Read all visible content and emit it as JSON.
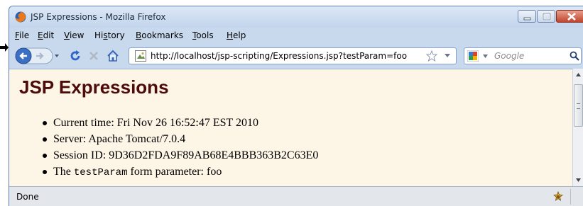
{
  "window": {
    "title": "JSP Expressions - Mozilla Firefox"
  },
  "menu": [
    {
      "accel": "F",
      "rest": "ile"
    },
    {
      "accel": "E",
      "rest": "dit"
    },
    {
      "accel": "V",
      "rest": "iew"
    },
    {
      "accel": "",
      "pre": "Hi",
      "accel2": "s",
      "rest": "tory"
    },
    {
      "accel": "B",
      "rest": "ookmarks"
    },
    {
      "accel": "T",
      "rest": "ools"
    },
    {
      "accel": "H",
      "rest": "elp"
    }
  ],
  "navigation": {
    "url": "http://localhost/jsp-scripting/Expressions.jsp?testParam=foo",
    "search_placeholder": "Google"
  },
  "page": {
    "heading": "JSP Expressions",
    "items": [
      {
        "label": "Current time: Fri Nov 26 16:52:47 EST 2010"
      },
      {
        "label": "Server: Apache Tomcat/7.0.4"
      },
      {
        "label": "Session ID: 9D36D2FDA9F89AB68E4BBB363B2C63E0"
      },
      {
        "pre": "The ",
        "code": "testParam",
        "post": " form parameter: foo"
      }
    ]
  },
  "status": {
    "text": "Done"
  },
  "icons": {
    "browser": "firefox-icon",
    "back": "back-arrow-icon",
    "forward": "forward-arrow-icon",
    "reload": "reload-icon",
    "stop": "stop-icon",
    "home": "home-icon",
    "bookmark": "star-icon",
    "search_engine": "google-icon",
    "search": "magnifier-icon",
    "status_addon": "bug-icon"
  },
  "colors": {
    "heading": "#4d0b0b",
    "content_background": "#fdf5e6",
    "chrome": "#c8d9ee"
  }
}
